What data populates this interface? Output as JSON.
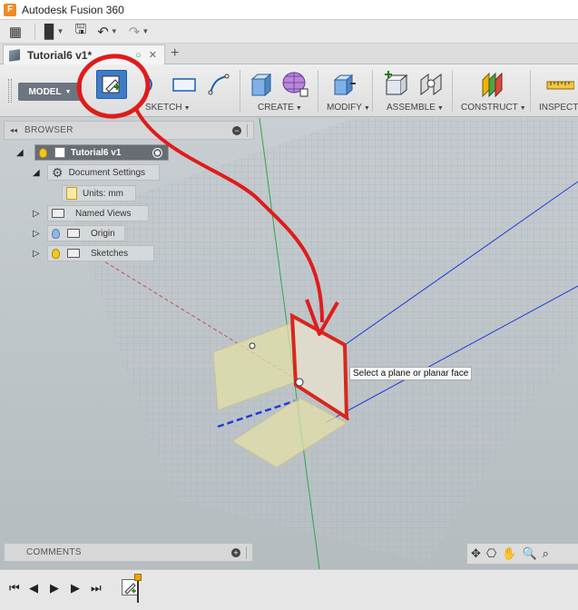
{
  "app": {
    "title": "Autodesk Fusion 360",
    "icon_letter": "F"
  },
  "quick_access": {
    "items": [
      {
        "name": "data-panel",
        "icon": "grid-icon",
        "glyph": "▦"
      },
      {
        "name": "file",
        "icon": "file-icon",
        "glyph": "▉"
      },
      {
        "name": "save",
        "icon": "save-icon",
        "glyph": "🖫"
      },
      {
        "name": "undo",
        "icon": "undo-icon",
        "glyph": "↶"
      },
      {
        "name": "redo",
        "icon": "redo-icon",
        "glyph": "↷"
      }
    ]
  },
  "document_tab": {
    "name": "Tutorial6 v1*",
    "new_tab_glyph": "+"
  },
  "workspace": {
    "label": "MODEL"
  },
  "toolbar": {
    "groups": [
      {
        "label": "SKETCH"
      },
      {
        "label": "CREATE"
      },
      {
        "label": "MODIFY"
      },
      {
        "label": "ASSEMBLE"
      },
      {
        "label": "CONSTRUCT"
      },
      {
        "label": "INSPECT"
      }
    ]
  },
  "browser": {
    "header": "BROWSER",
    "root": "Tutorial6 v1",
    "items": [
      {
        "label": "Document Settings"
      },
      {
        "label": "Units: mm"
      },
      {
        "label": "Named Views"
      },
      {
        "label": "Origin"
      },
      {
        "label": "Sketches"
      }
    ]
  },
  "viewport": {
    "tooltip": "Select a plane or planar face",
    "colors": {
      "x_axis": "#c8323c",
      "y_axis": "#2fa84b",
      "z_axis": "#1f3cd8",
      "plane": "#e3e0a8",
      "highlight": "#d9261c"
    }
  },
  "comments": {
    "label": "COMMENTS"
  },
  "navbar": {
    "items": [
      {
        "icon": "orbit-icon",
        "glyph": "✥"
      },
      {
        "icon": "look-at-icon",
        "glyph": "⎔"
      },
      {
        "icon": "pan-icon",
        "glyph": "✋"
      },
      {
        "icon": "zoom-icon",
        "glyph": "🔍"
      },
      {
        "icon": "fit-icon",
        "glyph": "⌕"
      }
    ]
  },
  "timeline": {
    "controls": [
      {
        "icon": "go-to-start-icon",
        "glyph": "⏮"
      },
      {
        "icon": "step-back-icon",
        "glyph": "◀"
      },
      {
        "icon": "play-icon",
        "glyph": "▶"
      },
      {
        "icon": "step-forward-icon",
        "glyph": "▶"
      },
      {
        "icon": "go-to-end-icon",
        "glyph": "⏭"
      }
    ]
  }
}
